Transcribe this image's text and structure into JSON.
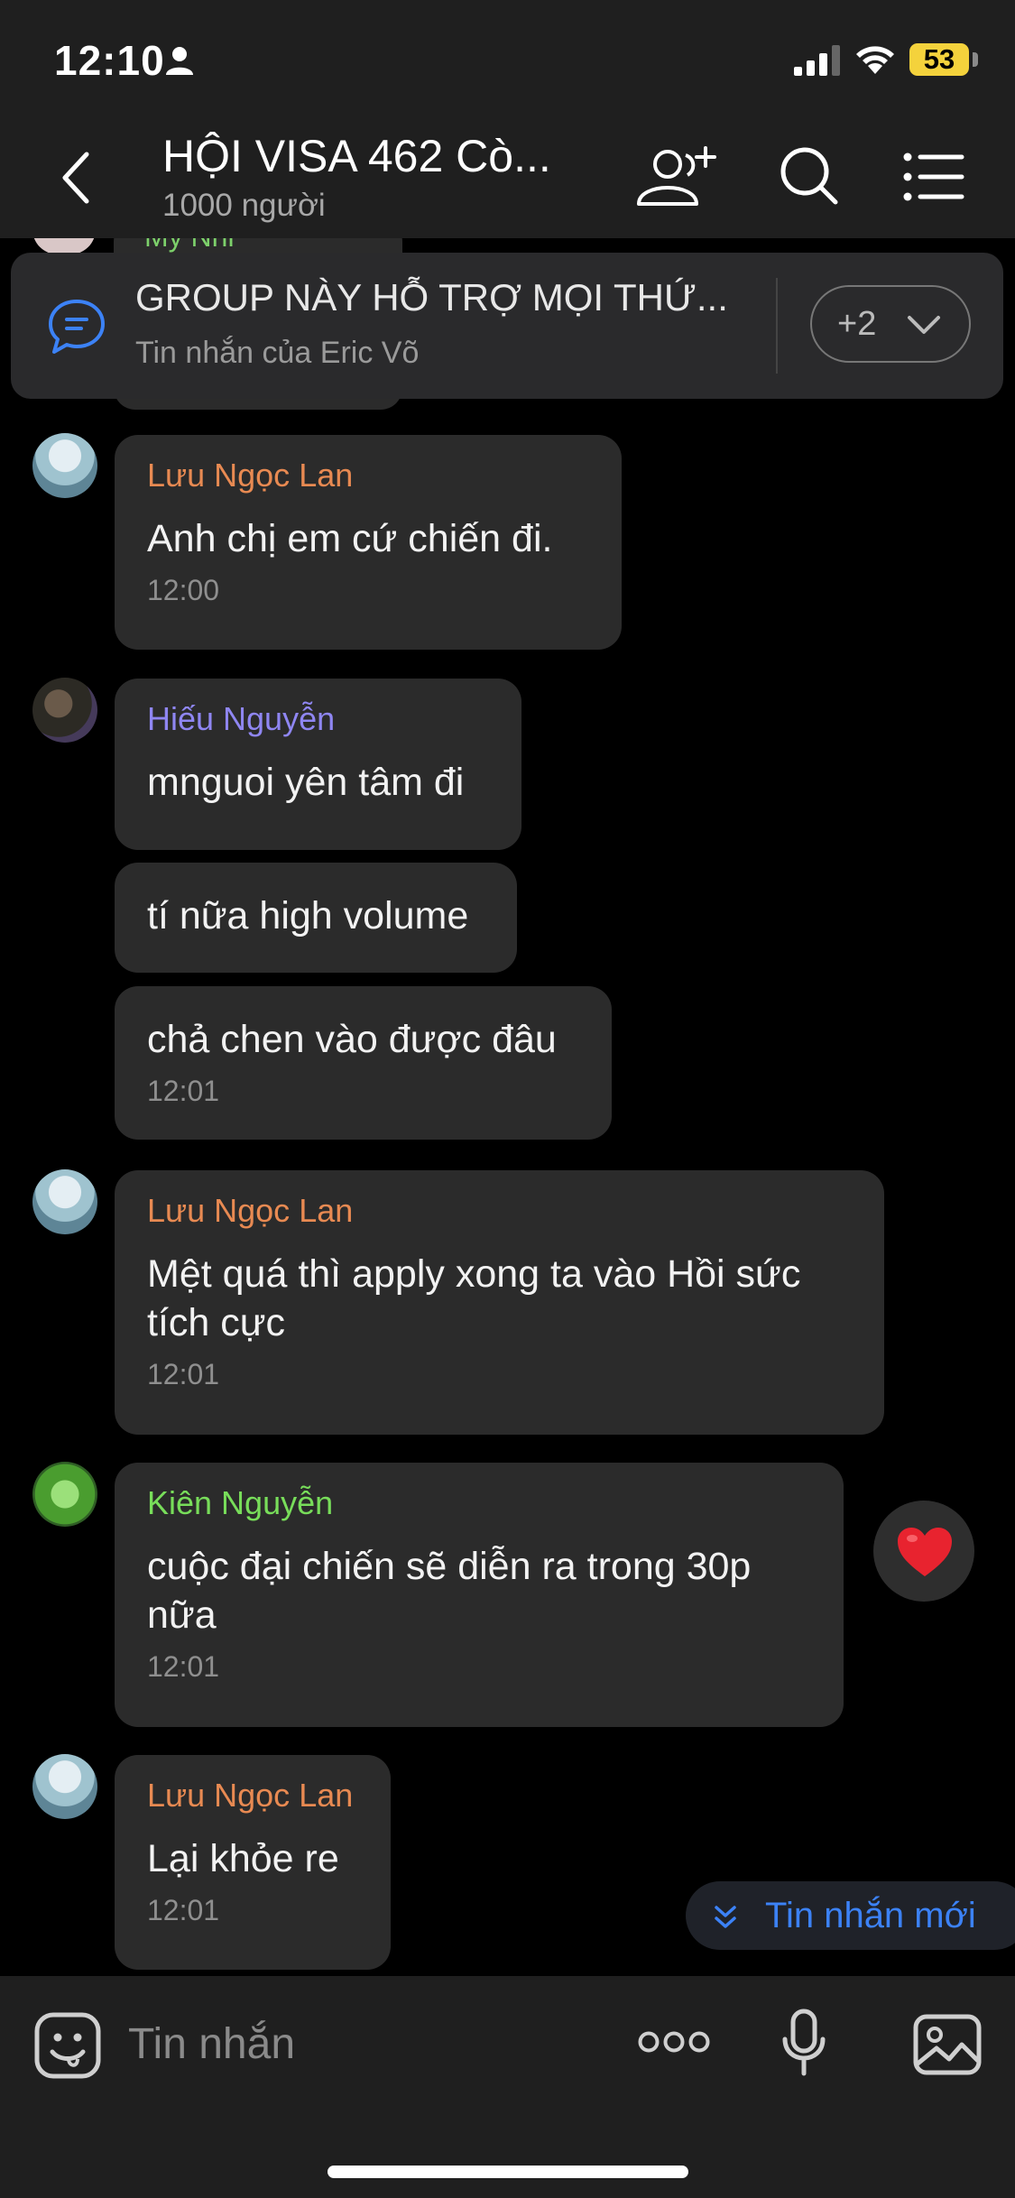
{
  "status_bar": {
    "time": "12:10",
    "battery": "53"
  },
  "header": {
    "title": "HỘI VISA 462 Cò...",
    "member_count": "1000 người"
  },
  "partial_message": {
    "sender": "My Nhi"
  },
  "pinned": {
    "title": "GROUP NÀY HỖ TRỢ MỌI THỨ...",
    "subtitle": "Tin nhắn của Eric Võ",
    "more": "+2"
  },
  "messages": [
    {
      "sender": "Lưu Ngọc Lan",
      "text": "Anh chị em cứ chiến đi.",
      "time": "12:00"
    },
    {
      "sender": "Hiếu Nguyễn",
      "text": "mnguoi yên tâm đi"
    },
    {
      "text": "tí nữa high volume"
    },
    {
      "text": "chả chen vào được đâu",
      "time": "12:01"
    },
    {
      "sender": "Lưu Ngọc Lan",
      "text": "Mệt quá thì apply xong ta vào Hồi sức tích cực",
      "time": "12:01"
    },
    {
      "sender": "Kiên Nguyễn",
      "text": "cuộc đại chiến sẽ diễn ra trong 30p nữa",
      "time": "12:01",
      "reaction": "heart"
    },
    {
      "sender": "Lưu Ngọc Lan",
      "text": "Lại khỏe re",
      "time": "12:01"
    }
  ],
  "new_message_button": "Tin nhắn mới",
  "composer": {
    "placeholder": "Tin nhắn"
  },
  "colors": {
    "sender_orange": "#e88a52",
    "sender_purple": "#8f86f2",
    "sender_green": "#78dd5a",
    "accent_blue": "#3c82f6",
    "bubble": "#2b2b2b"
  }
}
